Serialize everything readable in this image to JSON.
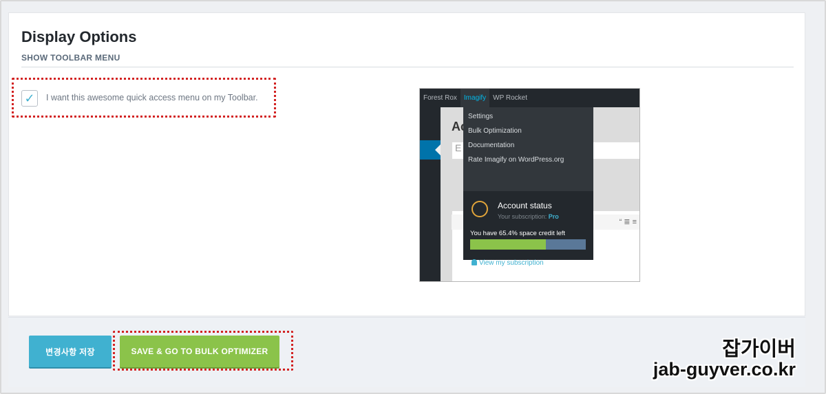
{
  "panel": {
    "title": "Display Options",
    "section_heading": "SHOW TOOLBAR MENU",
    "checkbox": {
      "checked": true,
      "label": "I want this awesome quick access menu on my Toolbar."
    }
  },
  "preview": {
    "adminbar_items": [
      "Forest Rox",
      "Imagify",
      "WP Rocket"
    ],
    "page_heading": "Ac",
    "input_placeholder": "E",
    "editor_toolbar": "“ ≣ ≡",
    "menu_items": [
      "Settings",
      "Bulk Optimization",
      "Documentation",
      "Rate Imagify on WordPress.org"
    ],
    "account_status_title": "Account status",
    "subscription_prefix": "Your subscription:",
    "subscription_plan": "Pro",
    "credit_text": "You have 65.4% space credit left",
    "credit_fraction": 0.654,
    "view_subscription_link": "View my subscription"
  },
  "footer": {
    "save_button": "변경사항 저장",
    "bulk_button": "SAVE & GO TO BULK OPTIMIZER"
  },
  "watermark": {
    "name": "잡가이버",
    "url": "jab-guyver.co.kr"
  },
  "colors": {
    "accent_blue": "#40b1d0",
    "accent_green": "#8bc34a",
    "highlight_red": "#d22222"
  }
}
